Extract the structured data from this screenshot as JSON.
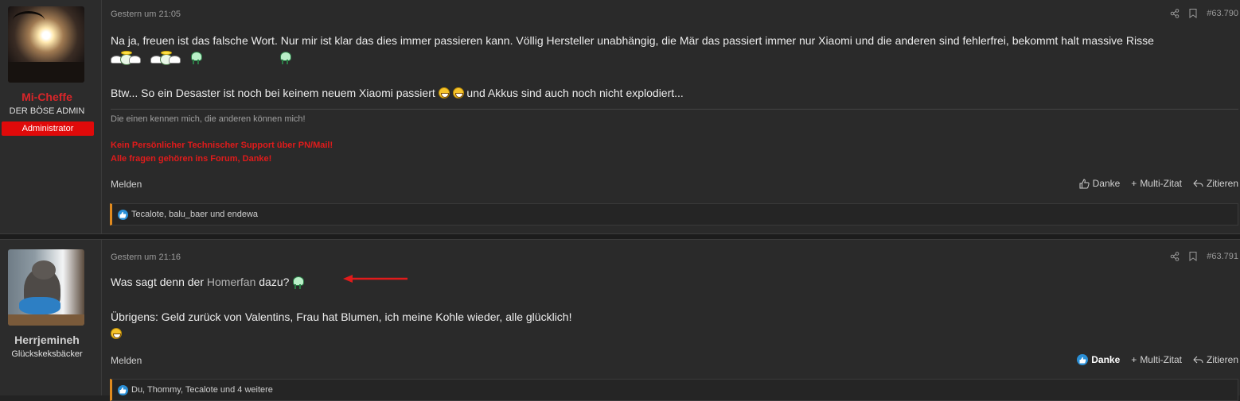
{
  "posts": [
    {
      "user": {
        "name": "Mi-Cheffe",
        "title": "DER BÖSE ADMIN",
        "banner": "Administrator",
        "name_color": "#d8262a",
        "banner_color": "#e00a0a"
      },
      "date": "Gestern um 21:05",
      "number": "#63.790",
      "body": {
        "line1": "Na ja, freuen ist das falsche Wort. Nur mir ist klar das dies immer passieren kann. Völlig Hersteller unabhängig, die Mär das passiert immer nur Xiaomi und die anderen sind fehlerfrei, bekommt halt massive Risse",
        "line2_emojis": [
          "angel-emoji",
          "angel-emoji",
          "alien-emoji",
          "alien-emoji"
        ],
        "line3_a": "Btw... So ein Desaster ist noch bei keinem neuem Xiaomi passiert",
        "line3_b": "und Akkus sind auch noch nicht explodiert..."
      },
      "signature": {
        "text": "Die einen kennen mich, die anderen können mich!",
        "red1": "Kein Persönlicher Technischer Support über PN/Mail!",
        "red2": "Alle fragen gehören ins Forum, Danke!"
      },
      "actions": {
        "report": "Melden",
        "like": "Danke",
        "multiquote": "Multi-Zitat",
        "quote": "Zitieren"
      },
      "reactions": "Tecalote, balu_baer und endewa"
    },
    {
      "user": {
        "name": "Herrjemineh",
        "title": "Glückskeksbäcker",
        "name_color": "#cfcfcf"
      },
      "date": "Gestern um 21:16",
      "number": "#63.791",
      "body": {
        "line1_a": "Was sagt denn der",
        "line1_mention": "Homerfan",
        "line1_b": "dazu?",
        "line2": "Übrigens: Geld zurück von Valentins, Frau hat Blumen, ich meine Kohle wieder, alle glücklich!"
      },
      "actions": {
        "report": "Melden",
        "like": "Danke",
        "multiquote": "Multi-Zitat",
        "quote": "Zitieren"
      },
      "reactions": "Du, Thommy, Tecalote und 4 weitere"
    }
  ],
  "colors": {
    "accent_orange": "#e08a1e",
    "like_blue": "#2a8fd6",
    "arrow_red": "#e01b1b"
  },
  "icons": [
    "share-icon",
    "bookmark-icon",
    "thumbs-up-icon",
    "plus-icon",
    "quote-reply-icon",
    "like-badge-icon"
  ]
}
